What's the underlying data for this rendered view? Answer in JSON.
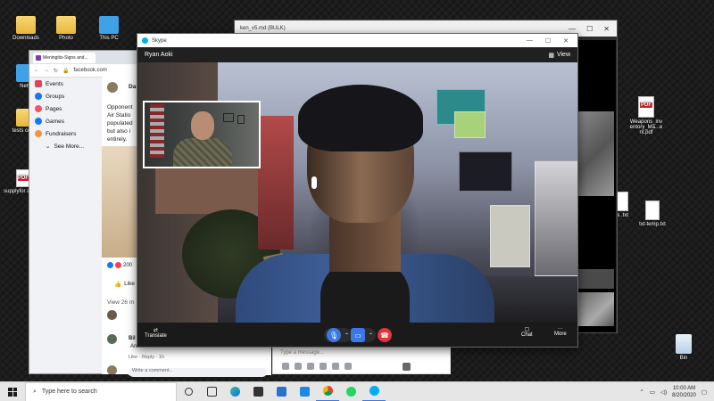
{
  "desktop": {
    "icons_left": [
      {
        "label": "Downloads"
      },
      {
        "label": "Photo"
      },
      {
        "label": "This PC"
      },
      {
        "label": "Netw"
      },
      {
        "label": "tests comm"
      },
      {
        "label": "supplyfor ansit..."
      }
    ],
    "icons_right": [
      {
        "label": "Weapons_inv entory_Ma...e nt.pdf"
      },
      {
        "label": "ds .txt"
      },
      {
        "label": "txt-temp.txt"
      },
      {
        "label": "Bin"
      }
    ],
    "bg_window_title": "ken_v5.md (BULK)"
  },
  "browser": {
    "tab_title": "Meningitis-Signs and...",
    "url": "facebook.com",
    "sidebar": [
      "Events",
      "Groups",
      "Pages",
      "Games",
      "Fundraisers",
      "See More..."
    ],
    "feed": {
      "author_initial": "Da",
      "post_lines": [
        "Opponent",
        "Air Statio",
        "populated",
        "but also i",
        "entirely."
      ],
      "reaction_count": "200",
      "like_label": "Like",
      "view_comments": "View 26 m",
      "comment_author": "Bil",
      "comment_text": "Am",
      "reply_line": "Like · Reply · 1h"
    }
  },
  "fb_comment": {
    "placeholder": "Type a message...",
    "comment_placeholder": "Write a comment..."
  },
  "skype": {
    "app_name": "Skype",
    "caller_name": "Ryan Aoki",
    "view_label": "View",
    "translate_label": "Translate",
    "chat_label": "Chat",
    "more_label": "More"
  },
  "taskbar": {
    "search_placeholder": "Type here to search",
    "time": "10:00 AM",
    "date": "8/20/2020"
  },
  "colors": {
    "skype_blue": "#00aff0",
    "call_blue": "#3b78e7",
    "hangup_red": "#e0343a"
  }
}
